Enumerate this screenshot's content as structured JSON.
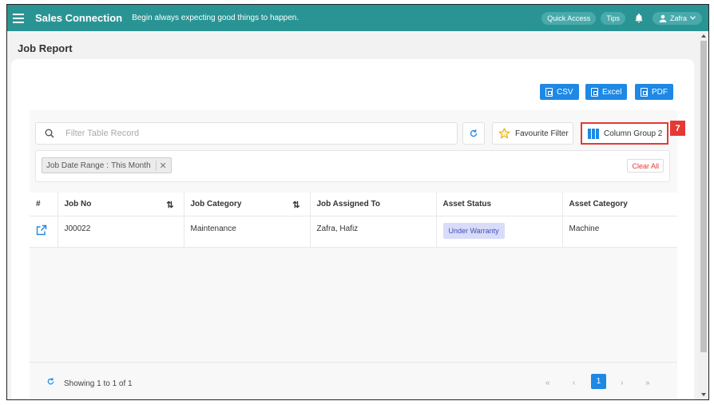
{
  "topbar": {
    "brand": "Sales Connection",
    "motto": "Begin always expecting good things to happen.",
    "quick_access": "Quick Access",
    "tips": "Tips",
    "user": "Zafra"
  },
  "page": {
    "title": "Job Report"
  },
  "exports": {
    "csv": "CSV",
    "excel": "Excel",
    "pdf": "PDF"
  },
  "toolbar": {
    "search_placeholder": "Filter Table Record",
    "favourite": "Favourite Filter",
    "column_group": "Column Group 2",
    "step_badge": "7"
  },
  "filters": {
    "chip_label": "Job Date Range",
    "chip_separator": ":",
    "chip_value": "This Month",
    "clear_all": "Clear All"
  },
  "table": {
    "headers": [
      "#",
      "Job No",
      "Job Category",
      "Job Assigned To",
      "Asset Status",
      "Asset Category"
    ],
    "rows": [
      {
        "job_no": "J00022",
        "category": "Maintenance",
        "assigned": "Zafra, Hafiz",
        "status": "Under Warranty",
        "asset_category": "Machine"
      }
    ]
  },
  "pager": {
    "info": "Showing 1 to 1 of 1",
    "first": "«",
    "prev": "‹",
    "current": "1",
    "next": "›",
    "last": "»"
  },
  "colors": {
    "topbar": "#2a9494",
    "accent": "#1e88e5",
    "highlight": "#e53935"
  }
}
